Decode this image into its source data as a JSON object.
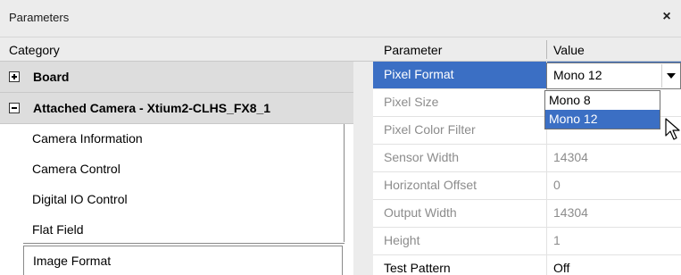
{
  "window": {
    "title": "Parameters",
    "close_glyph": "×"
  },
  "headers": {
    "category": "Category",
    "parameter": "Parameter",
    "value": "Value"
  },
  "tree": {
    "groups": [
      {
        "label": "Board",
        "expanded": false
      },
      {
        "label": "Attached Camera - Xtium2-CLHS_FX8_1",
        "expanded": true
      }
    ],
    "children": [
      {
        "label": "Camera Information"
      },
      {
        "label": "Camera Control"
      },
      {
        "label": "Digital IO Control"
      },
      {
        "label": "Flat Field"
      },
      {
        "label": "Image Format",
        "selected": true
      }
    ]
  },
  "parameters": [
    {
      "name": "Pixel Format",
      "value": "Mono 12",
      "state": "selected"
    },
    {
      "name": "Pixel Size",
      "value": "",
      "state": "readonly"
    },
    {
      "name": "Pixel Color Filter",
      "value": "",
      "state": "readonly"
    },
    {
      "name": "Sensor Width",
      "value": "14304",
      "state": "readonly"
    },
    {
      "name": "Horizontal Offset",
      "value": "0",
      "state": "readonly"
    },
    {
      "name": "Output Width",
      "value": "14304",
      "state": "readonly"
    },
    {
      "name": "Height",
      "value": "1",
      "state": "readonly"
    },
    {
      "name": "Test Pattern",
      "value": "Off",
      "state": "active"
    }
  ],
  "combo": {
    "value": "Mono 12",
    "options": [
      "Mono 8",
      "Mono 12"
    ],
    "highlighted": "Mono 12"
  },
  "colors": {
    "selection": "#3b6fc4",
    "disabled_text": "#8c8c8c",
    "group_bg": "#dddddd"
  }
}
